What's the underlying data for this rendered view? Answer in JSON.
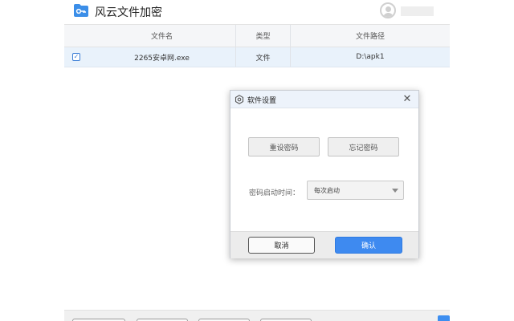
{
  "app": {
    "title": "风云文件加密",
    "icon": "folder-key-icon",
    "accent_color": "#3d8ef0"
  },
  "table": {
    "columns": [
      "文件名",
      "类型",
      "文件路径"
    ],
    "rows": [
      {
        "checked": true,
        "name": "2265安卓网.exe",
        "type": "文件",
        "path": "D:\\apk1"
      }
    ]
  },
  "dialog": {
    "title": "软件设置",
    "icon": "settings-icon",
    "reset_password_label": "重设密码",
    "forgot_password_label": "忘记密码",
    "password_launch_label": "密码启动时间：",
    "password_launch_value": "每次启动",
    "cancel_label": "取消",
    "confirm_label": "确认"
  }
}
